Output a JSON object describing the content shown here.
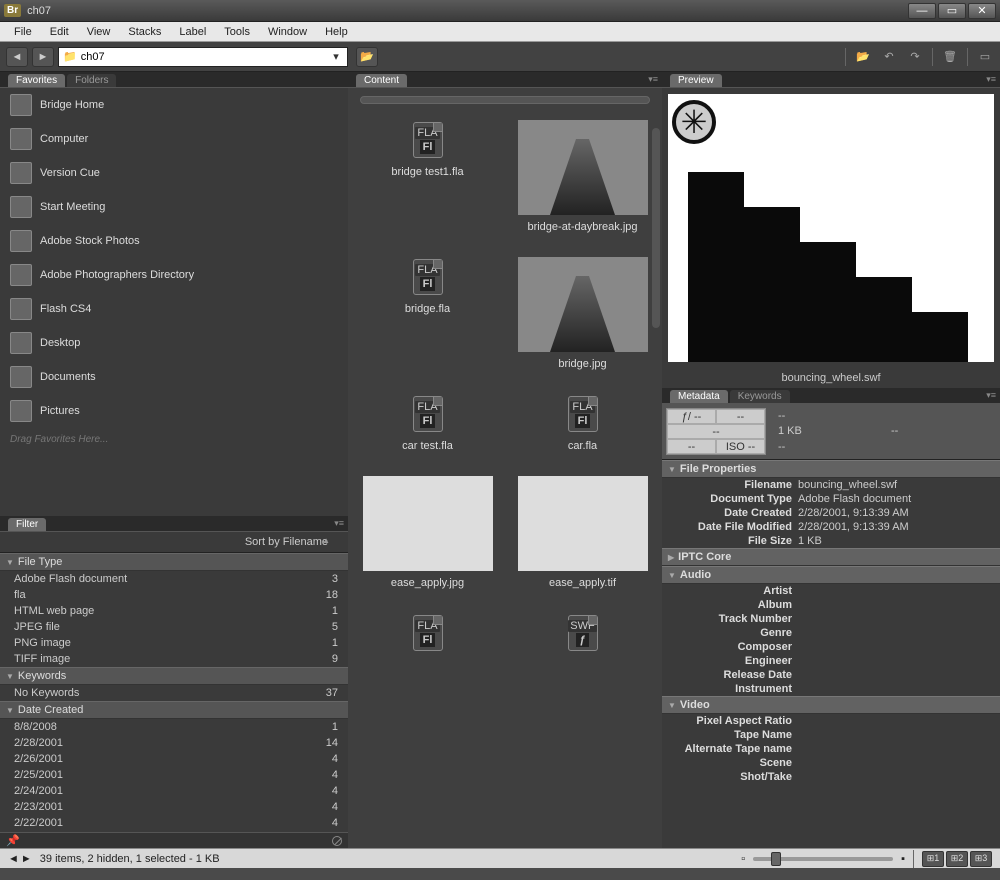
{
  "window": {
    "app_badge": "Br",
    "title": "ch07"
  },
  "menu": [
    "File",
    "Edit",
    "View",
    "Stacks",
    "Label",
    "Tools",
    "Window",
    "Help"
  ],
  "toolbar": {
    "path": "ch07"
  },
  "panels": {
    "favorites_tab": "Favorites",
    "folders_tab": "Folders",
    "filter_tab": "Filter",
    "content_tab": "Content",
    "preview_tab": "Preview",
    "metadata_tab": "Metadata",
    "keywords_tab": "Keywords"
  },
  "favorites": {
    "items": [
      {
        "label": "Bridge Home",
        "icon": "home"
      },
      {
        "label": "Computer",
        "icon": "computer"
      },
      {
        "label": "Version Cue",
        "icon": "versioncue"
      },
      {
        "label": "Start Meeting",
        "icon": "meeting"
      },
      {
        "label": "Adobe Stock Photos",
        "icon": "stock"
      },
      {
        "label": "Adobe Photographers Directory",
        "icon": "directory"
      },
      {
        "label": "Flash CS4",
        "icon": "folder"
      },
      {
        "label": "Desktop",
        "icon": "desktop"
      },
      {
        "label": "Documents",
        "icon": "documents"
      },
      {
        "label": "Pictures",
        "icon": "pictures"
      }
    ],
    "hint": "Drag Favorites Here..."
  },
  "filter": {
    "sort_label": "Sort by Filename",
    "groups": [
      {
        "name": "File Type",
        "rows": [
          {
            "label": "Adobe Flash document",
            "count": 3
          },
          {
            "label": "fla",
            "count": 18
          },
          {
            "label": "HTML web page",
            "count": 1
          },
          {
            "label": "JPEG file",
            "count": 5
          },
          {
            "label": "PNG image",
            "count": 1
          },
          {
            "label": "TIFF image",
            "count": 9
          }
        ]
      },
      {
        "name": "Keywords",
        "rows": [
          {
            "label": "No Keywords",
            "count": 37
          }
        ]
      },
      {
        "name": "Date Created",
        "rows": [
          {
            "label": "8/8/2008",
            "count": 1
          },
          {
            "label": "2/28/2001",
            "count": 14
          },
          {
            "label": "2/26/2001",
            "count": 4
          },
          {
            "label": "2/25/2001",
            "count": 4
          },
          {
            "label": "2/24/2001",
            "count": 4
          },
          {
            "label": "2/23/2001",
            "count": 4
          },
          {
            "label": "2/22/2001",
            "count": 4
          }
        ]
      }
    ]
  },
  "content": {
    "items": [
      {
        "name": "bridge test1.fla",
        "kind": "fla"
      },
      {
        "name": "bridge-at-daybreak.jpg",
        "kind": "photo"
      },
      {
        "name": "bridge.fla",
        "kind": "fla"
      },
      {
        "name": "bridge.jpg",
        "kind": "photo"
      },
      {
        "name": "car test.fla",
        "kind": "fla"
      },
      {
        "name": "car.fla",
        "kind": "fla"
      },
      {
        "name": "ease_apply.jpg",
        "kind": "ui"
      },
      {
        "name": "ease_apply.tif",
        "kind": "ui"
      }
    ]
  },
  "preview": {
    "caption": "bouncing_wheel.swf"
  },
  "metadata": {
    "header": {
      "f": "ƒ/ --",
      "shutter": "--",
      "awb": "--",
      "ev": "--",
      "iso": "ISO --",
      "res": "--",
      "size": "1 KB",
      "dpi": "--",
      "profile": "--"
    },
    "file_properties_hdr": "File Properties",
    "file_properties": [
      {
        "label": "Filename",
        "value": "bouncing_wheel.swf"
      },
      {
        "label": "Document Type",
        "value": "Adobe Flash document"
      },
      {
        "label": "Date Created",
        "value": "2/28/2001, 9:13:39 AM"
      },
      {
        "label": "Date File Modified",
        "value": "2/28/2001, 9:13:39 AM"
      },
      {
        "label": "File Size",
        "value": "1 KB"
      }
    ],
    "iptc_hdr": "IPTC Core",
    "audio_hdr": "Audio",
    "audio": [
      "Artist",
      "Album",
      "Track Number",
      "Genre",
      "Composer",
      "Engineer",
      "Release Date",
      "Instrument"
    ],
    "video_hdr": "Video",
    "video": [
      "Pixel Aspect Ratio",
      "Tape Name",
      "Alternate Tape name",
      "Scene",
      "Shot/Take"
    ]
  },
  "status": {
    "text": "39 items, 2 hidden, 1 selected - 1 KB"
  }
}
